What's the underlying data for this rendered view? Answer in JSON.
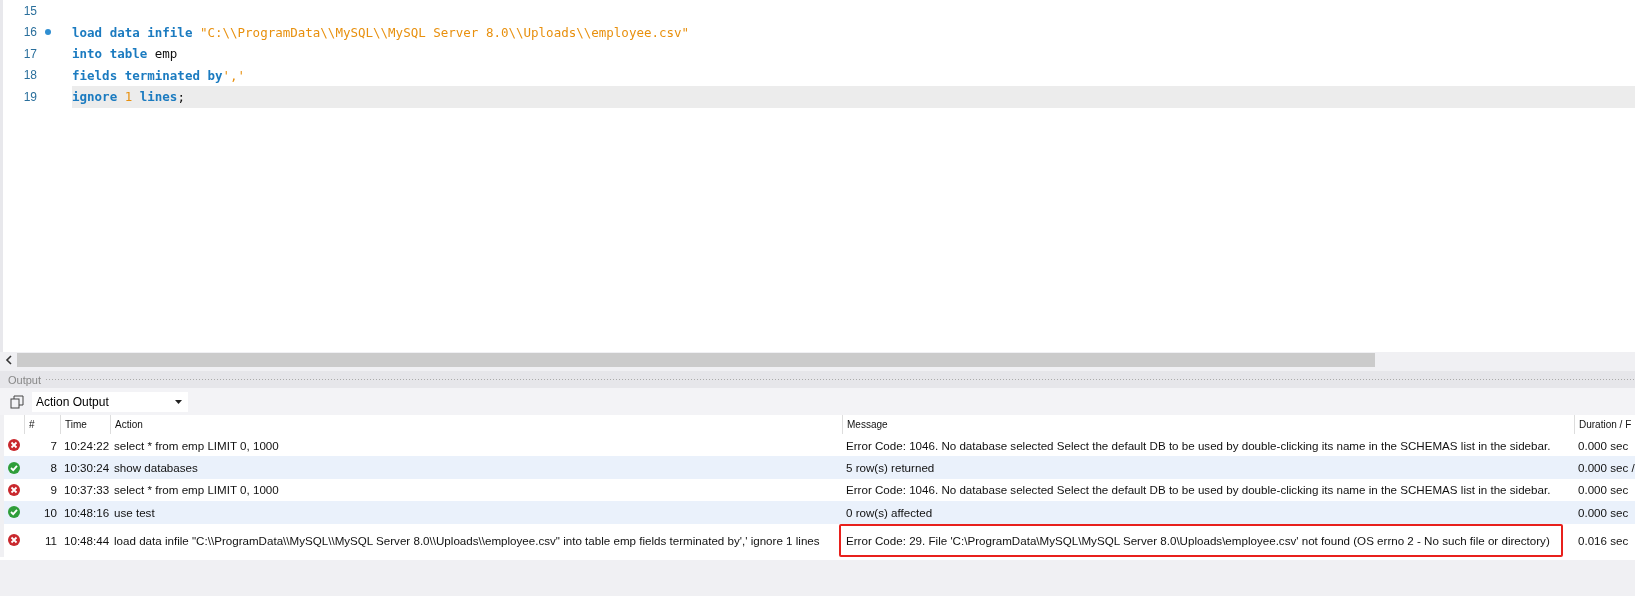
{
  "editor": {
    "lines": [
      {
        "number": "15",
        "marker": false,
        "current": false
      },
      {
        "number": "16",
        "marker": true,
        "current": false,
        "tokens": [
          {
            "kind": "keyword",
            "text": "load data infile "
          },
          {
            "kind": "string",
            "text": "\"C:\\\\ProgramData\\\\MySQL\\\\MySQL Server 8.0\\\\Uploads\\\\employee.csv\""
          }
        ]
      },
      {
        "number": "17",
        "marker": false,
        "current": false,
        "tokens": [
          {
            "kind": "keyword",
            "text": "into table "
          },
          {
            "kind": "plain",
            "text": "emp"
          }
        ]
      },
      {
        "number": "18",
        "marker": false,
        "current": false,
        "tokens": [
          {
            "kind": "keyword",
            "text": "fields terminated by"
          },
          {
            "kind": "string",
            "text": "','"
          }
        ]
      },
      {
        "number": "19",
        "marker": false,
        "current": true,
        "tokens": [
          {
            "kind": "keyword",
            "text": "ignore "
          },
          {
            "kind": "number",
            "text": "1"
          },
          {
            "kind": "keyword",
            "text": " lines"
          },
          {
            "kind": "plain",
            "text": ";"
          }
        ]
      }
    ]
  },
  "output": {
    "title": "Output",
    "selector": "Action Output",
    "columns": [
      "#",
      "Time",
      "Action",
      "Message",
      "Duration / F"
    ],
    "rows": [
      {
        "kind": "error",
        "highlighted": false,
        "number": "7",
        "time": "10:24:22",
        "action": "select * from emp LIMIT 0, 1000",
        "message": "Error Code: 1046. No database selected Select the default DB to be used by double-clicking its name in the SCHEMAS list in the sidebar.",
        "duration": "0.000 sec"
      },
      {
        "kind": "ok",
        "highlighted": false,
        "number": "8",
        "time": "10:30:24",
        "action": "show databases",
        "message": "5 row(s) returned",
        "duration": "0.000 sec /"
      },
      {
        "kind": "error",
        "highlighted": false,
        "number": "9",
        "time": "10:37:33",
        "action": "select * from emp LIMIT 0, 1000",
        "message": "Error Code: 1046. No database selected Select the default DB to be used by double-clicking its name in the SCHEMAS list in the sidebar.",
        "duration": "0.000 sec"
      },
      {
        "kind": "ok",
        "highlighted": false,
        "number": "10",
        "time": "10:48:16",
        "action": "use test",
        "message": "0 row(s) affected",
        "duration": "0.000 sec"
      },
      {
        "kind": "error",
        "highlighted": true,
        "number": "11",
        "time": "10:48:44",
        "action": "load data infile \"C:\\\\ProgramData\\\\MySQL\\\\MySQL Server 8.0\\\\Uploads\\\\employee.csv\" into table emp fields terminated by',' ignore 1 lines",
        "message": "Error Code: 29. File 'C:\\ProgramData\\MySQL\\MySQL Server 8.0\\Uploads\\employee.csv' not found (OS errno 2 - No such file or directory)",
        "duration": "0.016 sec"
      }
    ]
  }
}
